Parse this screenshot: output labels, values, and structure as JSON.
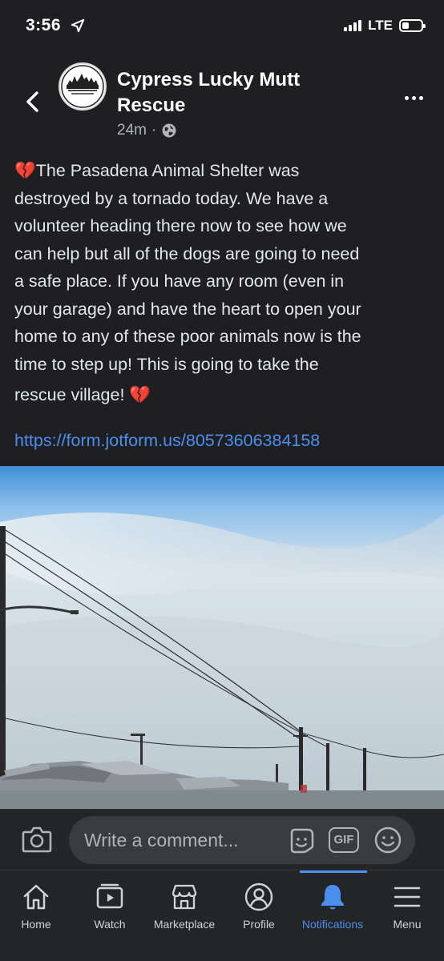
{
  "status_bar": {
    "time": "3:56",
    "network": "LTE",
    "signal_bars": 4,
    "battery_level": 0.35,
    "icons": [
      "location-arrow-icon",
      "cellular-signal-icon",
      "battery-icon"
    ]
  },
  "post": {
    "page_name": "Cypress Lucky Mutt Rescue",
    "avatar_logo_text": "CYPRESS LUCKY MUTT RESCUE",
    "time_ago": "24m",
    "separator": "·",
    "privacy_icon": "globe-icon",
    "body_lines": [
      "💔The Pasadena Animal Shelter was",
      "destroyed by a tornado today. We have a",
      "volunteer heading there now to see how we",
      "can help but all of the dogs are going to need",
      "a safe place. If you have any room (even in",
      "your garage) and have the heart to open your",
      "home to any of these poor animals now is the",
      "time to step up! This is going to take the",
      "rescue village! 💔"
    ],
    "link": "https://form.jotform.us/80573606384158"
  },
  "comment_bar": {
    "placeholder": "Write a comment...",
    "gif_label": "GIF",
    "icons": [
      "camera-icon",
      "sticker-icon",
      "gif-icon",
      "emoji-icon"
    ]
  },
  "tab_bar": {
    "accent_color": "#4a8ff0",
    "active": "Notifications",
    "tabs": [
      {
        "label": "Home",
        "icon": "home-icon"
      },
      {
        "label": "Watch",
        "icon": "watch-icon"
      },
      {
        "label": "Marketplace",
        "icon": "marketplace-icon"
      },
      {
        "label": "Profile",
        "icon": "profile-icon"
      },
      {
        "label": "Notifications",
        "icon": "bell-icon"
      },
      {
        "label": "Menu",
        "icon": "menu-icon"
      }
    ]
  }
}
